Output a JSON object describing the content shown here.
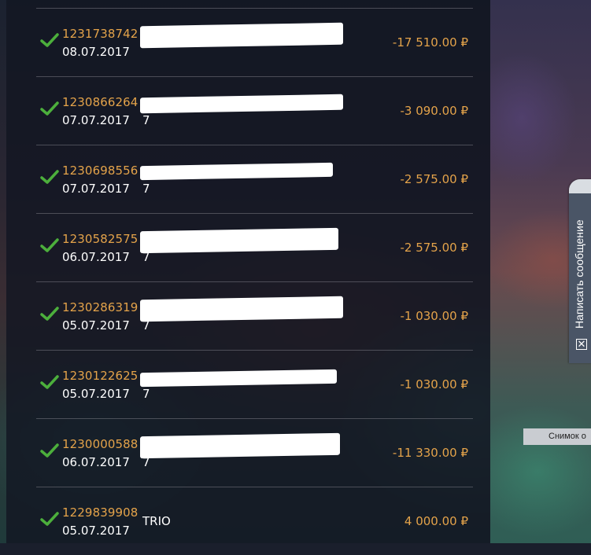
{
  "transactions": [
    {
      "id": "1231738742",
      "date": "08.07.2017",
      "desc": "",
      "amount": "-17 510.00 ₽"
    },
    {
      "id": "1230866264",
      "date": "07.07.2017",
      "desc": "7",
      "amount": "-3 090.00 ₽"
    },
    {
      "id": "1230698556",
      "date": "07.07.2017",
      "desc": "7",
      "amount": "-2 575.00 ₽"
    },
    {
      "id": "1230582575",
      "date": "06.07.2017",
      "desc": "7",
      "amount": "-2 575.00 ₽"
    },
    {
      "id": "1230286319",
      "date": "05.07.2017",
      "desc": "7",
      "amount": "-1 030.00 ₽"
    },
    {
      "id": "1230122625",
      "date": "05.07.2017",
      "desc": "7",
      "amount": "-1 030.00 ₽"
    },
    {
      "id": "1230000588",
      "date": "06.07.2017",
      "desc": "7",
      "amount": "-11 330.00 ₽"
    },
    {
      "id": "1229839908",
      "date": "05.07.2017",
      "desc": "TRIO",
      "amount": "4 000.00 ₽"
    }
  ],
  "feedback": {
    "label": "Написать сообщение",
    "icon": "close-icon"
  },
  "screenshot_label": "Снимок о",
  "icons": {
    "status": "checkmark-icon"
  },
  "colors": {
    "accent": "#e4a34a",
    "check": "#4caf3c",
    "text": "#ffffff"
  }
}
